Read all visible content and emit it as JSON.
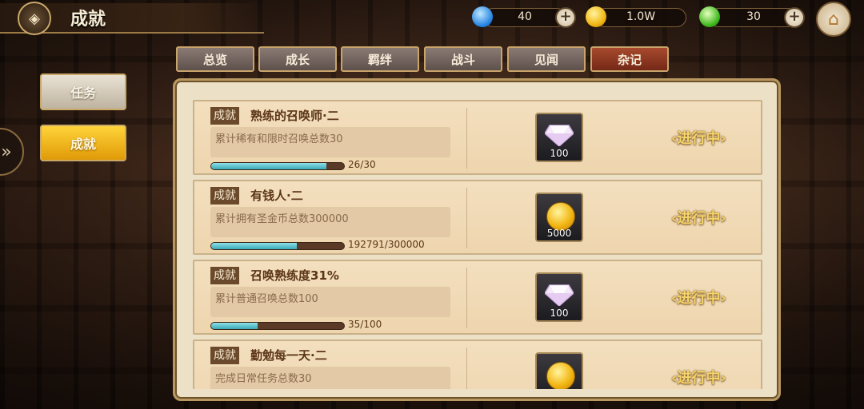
{
  "header": {
    "title": "成就",
    "back_icon": "diamond-back-icon",
    "currencies": [
      {
        "name": "summon-crystal",
        "value": "40",
        "color": "#3aa0ff"
      },
      {
        "name": "gold-coin",
        "value": "1.0W",
        "color": "#f2b714"
      },
      {
        "name": "green-gem",
        "value": "30",
        "color": "#5ccf3a"
      }
    ],
    "plus_label": "+",
    "home_icon": "home-icon"
  },
  "side": {
    "tabs": [
      {
        "label": "任务",
        "active": false
      },
      {
        "label": "成就",
        "active": true
      }
    ],
    "expand_arrow": "»"
  },
  "categories": [
    {
      "label": "总览"
    },
    {
      "label": "成长"
    },
    {
      "label": "羁绊"
    },
    {
      "label": "战斗"
    },
    {
      "label": "见闻"
    },
    {
      "label": "杂记",
      "active": true
    }
  ],
  "achievements": [
    {
      "tag": "成就",
      "name": "熟练的召唤师·二",
      "desc": "累计稀有和限时召唤总数30",
      "progress_text": "26/30",
      "progress": 0.867,
      "reward": {
        "type": "crystal",
        "qty": "100"
      },
      "status": "进行中"
    },
    {
      "tag": "成就",
      "name": "有钱人·二",
      "desc": "累计拥有圣金币总数300000",
      "progress_text": "192791/300000",
      "progress": 0.643,
      "reward": {
        "type": "coin",
        "qty": "5000"
      },
      "status": "进行中"
    },
    {
      "tag": "成就",
      "name": "召唤熟练度31%",
      "desc": "累计普通召唤总数100",
      "progress_text": "35/100",
      "progress": 0.35,
      "reward": {
        "type": "crystal",
        "qty": "100"
      },
      "status": "进行中"
    },
    {
      "tag": "成就",
      "name": "勤勉每一天·二",
      "desc": "完成日常任务总数30",
      "progress_text": "",
      "progress": 0,
      "reward": {
        "type": "coin",
        "qty": ""
      },
      "status": "进行中"
    }
  ]
}
